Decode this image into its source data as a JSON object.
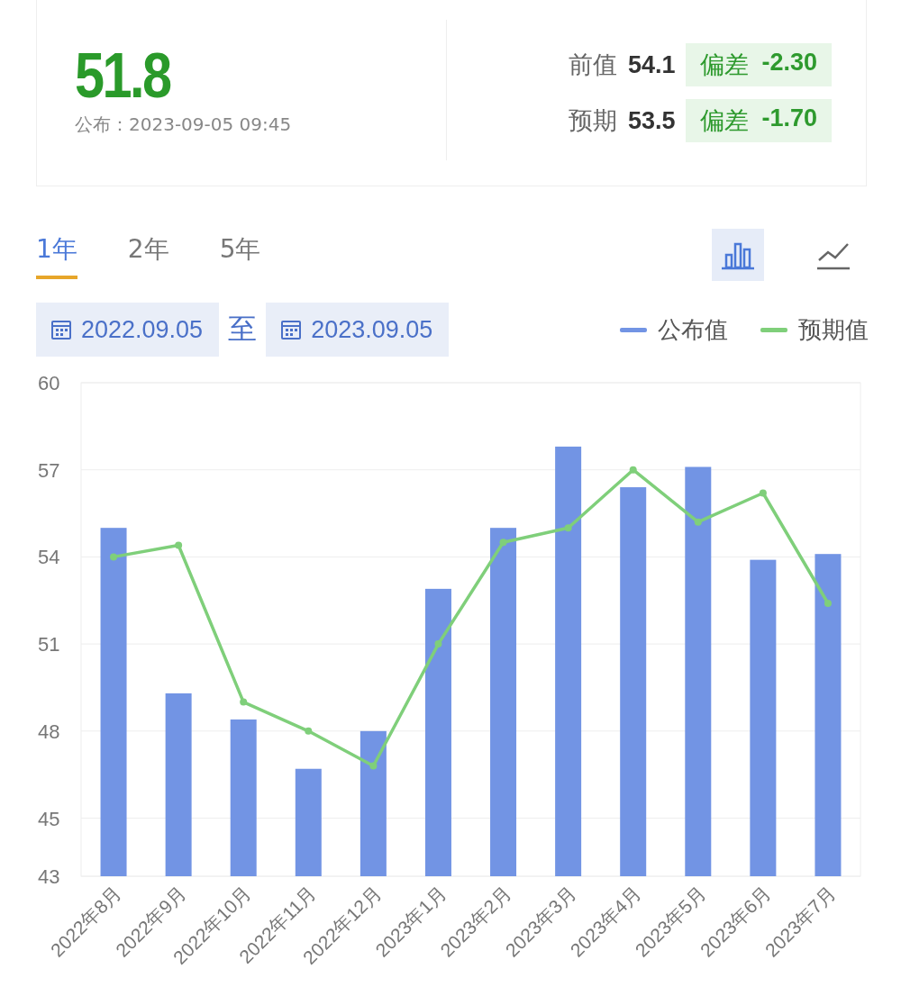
{
  "summary": {
    "value": "51.8",
    "published": "公布：2023-09-05 09:45"
  },
  "comparisons": [
    {
      "label": "前值",
      "value": "54.1",
      "deviation_label": "偏差",
      "deviation": "-2.30"
    },
    {
      "label": "预期",
      "value": "53.5",
      "deviation_label": "偏差",
      "deviation": "-1.70"
    }
  ],
  "range_tabs": [
    {
      "label": "1年",
      "selected": true
    },
    {
      "label": "2年",
      "selected": false
    },
    {
      "label": "5年",
      "selected": false
    }
  ],
  "chart_types": [
    {
      "kind": "bar",
      "selected": true
    },
    {
      "kind": "line",
      "selected": false
    }
  ],
  "date_range": {
    "start": "2022.09.05",
    "separator": "至",
    "end": "2023.09.05"
  },
  "chart": {
    "chart_data": {
      "type": "bar",
      "categories": [
        "2022年8月",
        "2022年9月",
        "2022年10月",
        "2022年11月",
        "2022年12月",
        "2023年1月",
        "2023年2月",
        "2023年3月",
        "2023年4月",
        "2023年5月",
        "2023年6月",
        "2023年7月"
      ],
      "series": [
        {
          "name": "公布值",
          "type": "bar",
          "color": "#7294e4",
          "values": [
            55.0,
            49.3,
            48.4,
            46.7,
            48.0,
            52.9,
            55.0,
            57.8,
            56.4,
            57.1,
            53.9,
            54.1
          ]
        },
        {
          "name": "预期值",
          "type": "line",
          "marker": "circle",
          "color": "#7fcf7a",
          "values": [
            54.0,
            54.4,
            49.0,
            48.0,
            46.8,
            51.0,
            54.5,
            55.0,
            57.0,
            55.2,
            56.2,
            52.4
          ]
        }
      ],
      "grid": true,
      "ylim": [
        43,
        60
      ],
      "yticks": [
        43,
        45,
        48,
        51,
        54,
        57,
        60
      ]
    }
  }
}
